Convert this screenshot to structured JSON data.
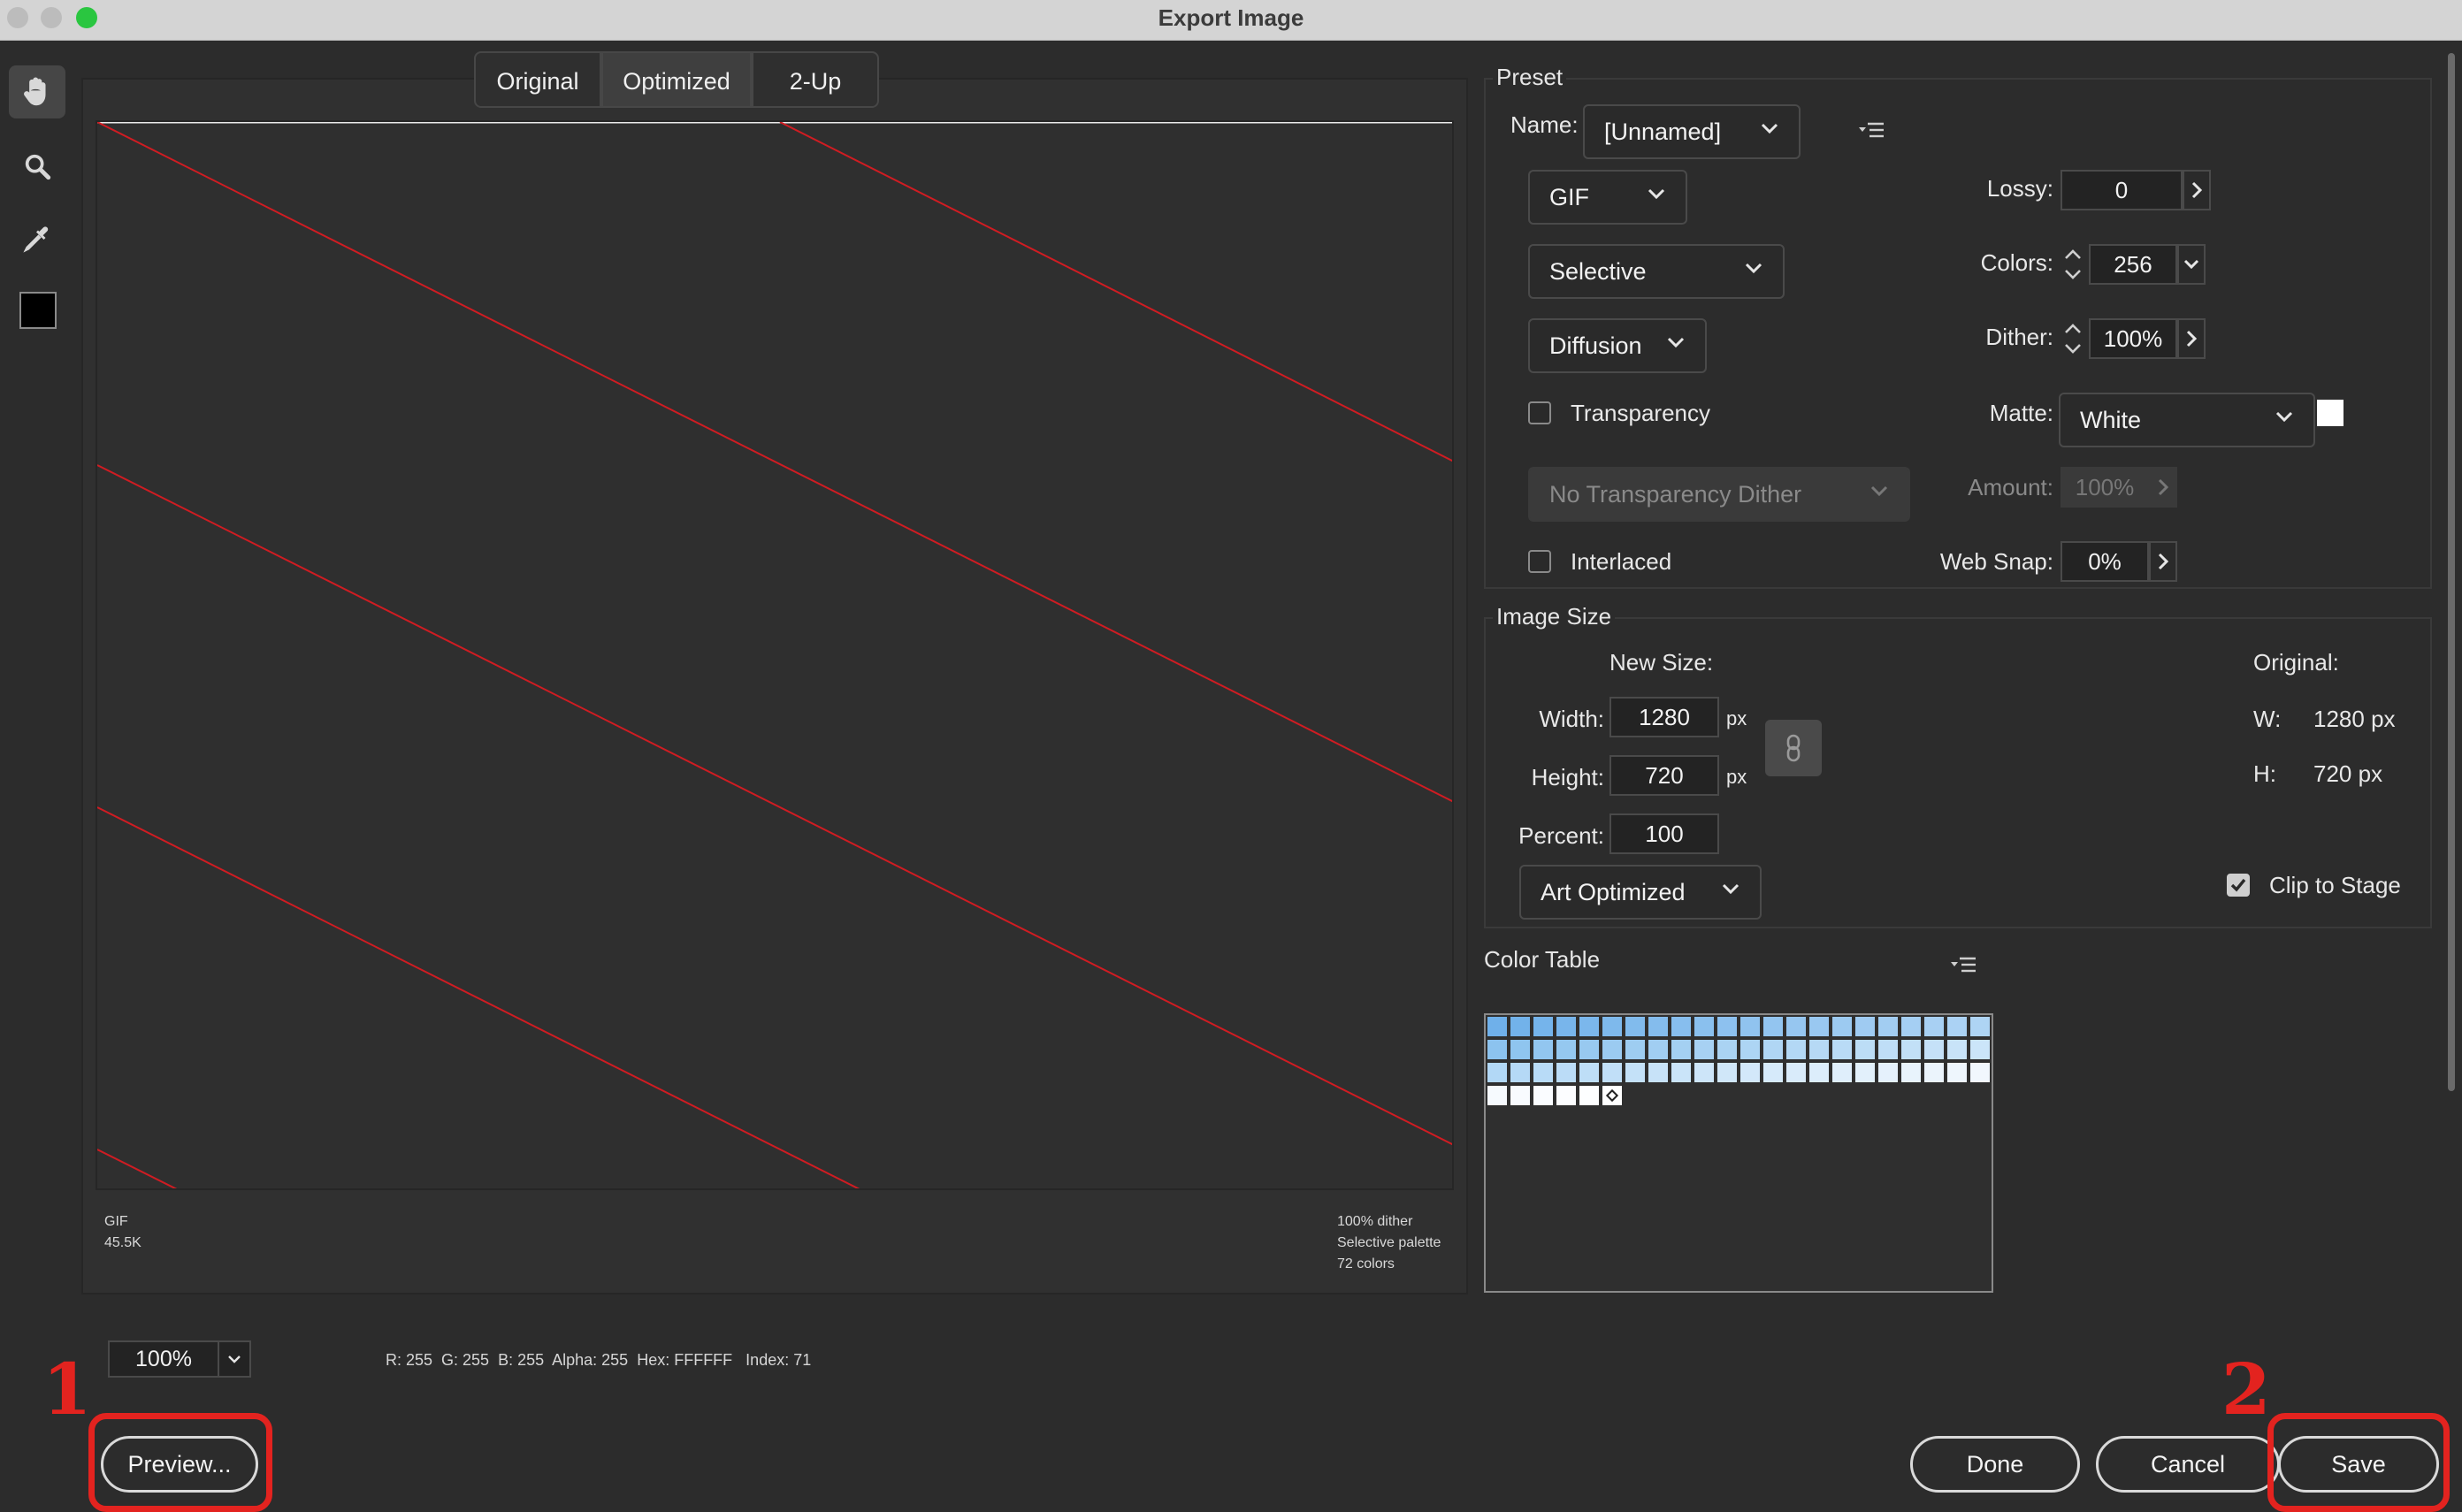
{
  "window": {
    "title": "Export Image"
  },
  "colors": {
    "accent_red": "#e3231f",
    "stroke_red": "#d01c22",
    "bg": "#2c2c2c"
  },
  "toolbar": {
    "tools": [
      {
        "name": "hand",
        "icon": "hand-icon"
      },
      {
        "name": "zoom",
        "icon": "zoom-icon"
      },
      {
        "name": "eyedropper",
        "icon": "eyedropper-icon"
      },
      {
        "name": "swatch",
        "icon": "color-swatch-icon",
        "color": "#000000"
      }
    ]
  },
  "view_tabs": [
    "Original",
    "Optimized",
    "2-Up"
  ],
  "view_tab_selected": "Optimized",
  "preview": {
    "format": "GIF",
    "size": "45.5K",
    "info_line1": "100% dither",
    "info_line2": "Selective palette",
    "info_line3": "72 colors"
  },
  "zoom": {
    "value": "100%"
  },
  "pixel_info": "R: 255  G: 255  B: 255  Alpha: 255  Hex: FFFFFF   Index: 71",
  "preset": {
    "title": "Preset",
    "name_label": "Name:",
    "name_value": "[Unnamed]",
    "format": "GIF",
    "palette": "Selective",
    "dither_algo": "Diffusion",
    "transparency_label": "Transparency",
    "transparency_checked": false,
    "transparency_dither": "No Transparency Dither",
    "interlaced_label": "Interlaced",
    "interlaced_checked": false,
    "lossy_label": "Lossy:",
    "lossy_value": "0",
    "colors_label": "Colors:",
    "colors_value": "256",
    "dither_label": "Dither:",
    "dither_value": "100%",
    "matte_label": "Matte:",
    "matte_value": "White",
    "matte_color": "#ffffff",
    "amount_label": "Amount:",
    "amount_value": "100%",
    "websnap_label": "Web Snap:",
    "websnap_value": "0%"
  },
  "image_size": {
    "title": "Image Size",
    "new_size_label": "New Size:",
    "width_label": "Width:",
    "width_value": "1280",
    "height_label": "Height:",
    "height_value": "720",
    "percent_label": "Percent:",
    "percent_value": "100",
    "unit": "px",
    "quality": "Art Optimized",
    "original_label": "Original:",
    "orig_w_label": "W:",
    "orig_w_value": "1280 px",
    "orig_h_label": "H:",
    "orig_h_value": "720 px",
    "clip_label": "Clip to Stage",
    "clip_checked": true
  },
  "color_table": {
    "title": "Color Table",
    "count": 72,
    "rows": [
      [
        "#6fb0ea",
        "#72b2ea",
        "#75b4eb",
        "#78b5eb",
        "#7bb7ec",
        "#7eb9ec",
        "#81bbed",
        "#84bced",
        "#87beee",
        "#8ac0ee",
        "#8dc1ef",
        "#90c3ef",
        "#93c5f0",
        "#96c6f0",
        "#99c8f1",
        "#9ccaf1",
        "#9fcbf2",
        "#a2cdf2",
        "#a5cff3",
        "#a8d0f3",
        "#abd2f4",
        "#aed4f4"
      ],
      [
        "#8cc3ef",
        "#8fc5ef",
        "#92c6f0",
        "#95c8f0",
        "#98c9f0",
        "#9bcbf1",
        "#9ecdf1",
        "#a1cef2",
        "#a4d0f2",
        "#a7d1f3",
        "#aad3f3",
        "#add5f4",
        "#b0d6f4",
        "#b3d8f5",
        "#b6d9f5",
        "#b9dbf6",
        "#bcddf6",
        "#bfdef7",
        "#c2e0f7",
        "#c5e1f8",
        "#c8e3f8",
        "#cbe5f9"
      ],
      [
        "#b2d8f6",
        "#b5d9f6",
        "#b8dbf7",
        "#bbdcf7",
        "#bedef7",
        "#c1dff8",
        "#c4e1f8",
        "#c7e2f8",
        "#cae4f9",
        "#cde5f9",
        "#d0e7f9",
        "#d3e8fa",
        "#d6eafa",
        "#d9ebfa",
        "#dcedfb",
        "#dfeefb",
        "#e2f0fb",
        "#e5f1fc",
        "#e8f3fc",
        "#ebf4fc",
        "#eef6fd",
        "#f1f7fd"
      ],
      [
        "#f6fafe",
        "#f8fbfe",
        "#fafcff",
        "#fcfdff",
        "#fdfeff",
        "#ffffff"
      ]
    ]
  },
  "buttons": {
    "preview": "Preview...",
    "done": "Done",
    "cancel": "Cancel",
    "save": "Save"
  },
  "annotations": {
    "marker1": "1",
    "marker2": "2"
  }
}
